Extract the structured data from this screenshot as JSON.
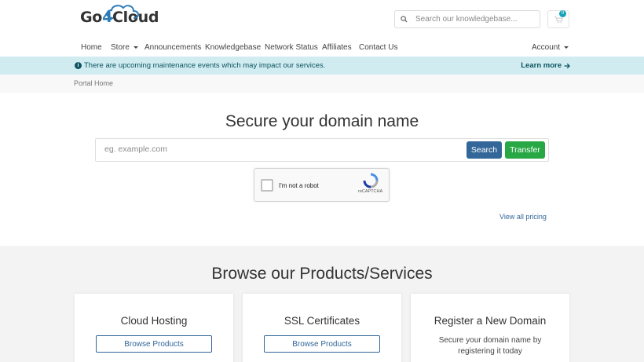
{
  "brand": {
    "logo_text_pre": "Go",
    "logo_text_num": "4",
    "logo_text_post": "Cloud"
  },
  "search": {
    "placeholder": "Search our knowledgebase...",
    "icon": "search-icon"
  },
  "cart": {
    "count": "0",
    "icon": "cart-icon"
  },
  "nav": {
    "home": "Home",
    "store": "Store",
    "announcements": "Announcements",
    "knowledgebase": "Knowledgebase",
    "network_status": "Network Status",
    "affiliates": "Affiliates",
    "contact": "Contact Us",
    "account": "Account"
  },
  "alert": {
    "icon": "info-icon",
    "text": "There are upcoming maintenance events which may impact our services.",
    "link": "Learn more",
    "link_icon": "arrow-right-icon"
  },
  "breadcrumb": {
    "home": "Portal Home"
  },
  "domain": {
    "title": "Secure your domain name",
    "placeholder": "eg. example.com",
    "search_label": "Search",
    "transfer_label": "Transfer",
    "pricing_link": "View all pricing"
  },
  "captcha": {
    "label": "I'm not a robot",
    "brand": "reCAPTCHA"
  },
  "products": {
    "title": "Browse our Products/Services",
    "cards": [
      {
        "title": "Cloud Hosting",
        "button": "Browse Products"
      },
      {
        "title": "SSL Certificates",
        "button": "Browse Products"
      },
      {
        "title": "Register a New Domain",
        "desc": "Secure your domain name by registering it today"
      }
    ]
  },
  "colors": {
    "primary": "#336699",
    "success": "#28a745",
    "alert_bg": "#d1ecf1",
    "alert_text": "#0c5460",
    "section_bg": "#f3f3f3"
  }
}
